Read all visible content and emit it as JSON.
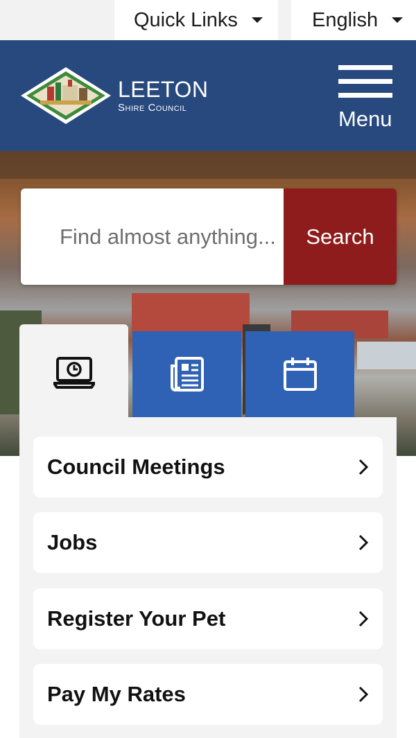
{
  "utility_bar": {
    "quick_links_label": "Quick Links",
    "language_label": "English"
  },
  "header": {
    "logo_main": "LEETON",
    "logo_sub": "Shire Council",
    "menu_label": "Menu"
  },
  "search": {
    "placeholder": "Find almost anything...",
    "button_label": "Search"
  },
  "tabs": [
    {
      "icon": "computer-clock-icon",
      "active": true
    },
    {
      "icon": "newspaper-icon",
      "active": false
    },
    {
      "icon": "calendar-icon",
      "active": false
    }
  ],
  "quick_items": [
    {
      "label": "Council Meetings"
    },
    {
      "label": "Jobs"
    },
    {
      "label": "Register Your Pet"
    },
    {
      "label": "Pay My Rates"
    }
  ],
  "colors": {
    "header_blue": "#27497e",
    "tab_blue": "#2f62b5",
    "search_red": "#8f1c1c",
    "panel_grey": "#f3f3f3"
  }
}
